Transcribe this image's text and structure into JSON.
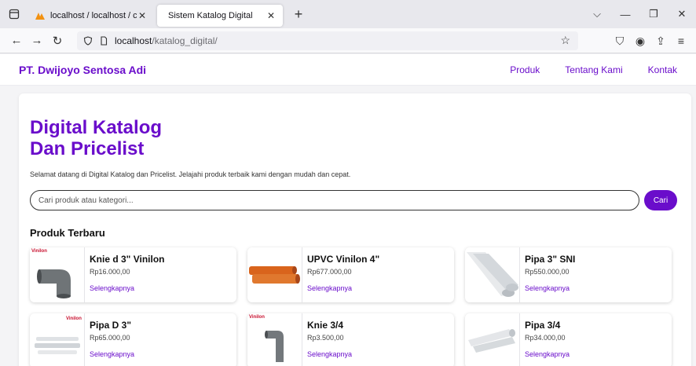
{
  "browser": {
    "tabs": [
      {
        "label": "localhost / localhost / catalog_"
      },
      {
        "label": "Sistem Katalog Digital"
      }
    ],
    "url_host": "localhost",
    "url_path": "/katalog_digital/"
  },
  "site": {
    "brand": "PT. Dwijoyo Sentosa Adi",
    "nav": [
      "Produk",
      "Tentang Kami",
      "Kontak"
    ]
  },
  "hero": {
    "title_line1": "Digital Katalog",
    "title_line2": "Dan Pricelist",
    "description": "Selamat datang di Digital Katalog dan Pricelist. Jelajahi produk terbaik kami dengan mudah dan cepat."
  },
  "search": {
    "placeholder": "Cari produk atau kategori...",
    "button": "Cari"
  },
  "section_title": "Produk Terbaru",
  "products": [
    {
      "name": "Knie d 3\" Vinilon",
      "price": "Rp16.000,00",
      "link": "Selengkapnya",
      "brand": "Vinilon",
      "image": "grey-elbow"
    },
    {
      "name": "UPVC Vinilon 4\"",
      "price": "Rp677.000,00",
      "link": "Selengkapnya",
      "brand": "",
      "image": "orange-pipes"
    },
    {
      "name": "Pipa 3\" SNI",
      "price": "Rp550.000,00",
      "link": "Selengkapnya",
      "brand": "",
      "image": "white-pipes"
    },
    {
      "name": "Pipa D 3\"",
      "price": "Rp65.000,00",
      "link": "Selengkapnya",
      "brand": "Vinilon",
      "image": "white-pipes-stack"
    },
    {
      "name": "Knie 3/4",
      "price": "Rp3.500,00",
      "link": "Selengkapnya",
      "brand": "Vinilon",
      "image": "grey-elbow-small"
    },
    {
      "name": "Pipa 3/4",
      "price": "Rp34.000,00",
      "link": "Selengkapnya",
      "brand": "",
      "image": "white-pipes"
    }
  ],
  "colors": {
    "accent": "#6a0dcb"
  }
}
